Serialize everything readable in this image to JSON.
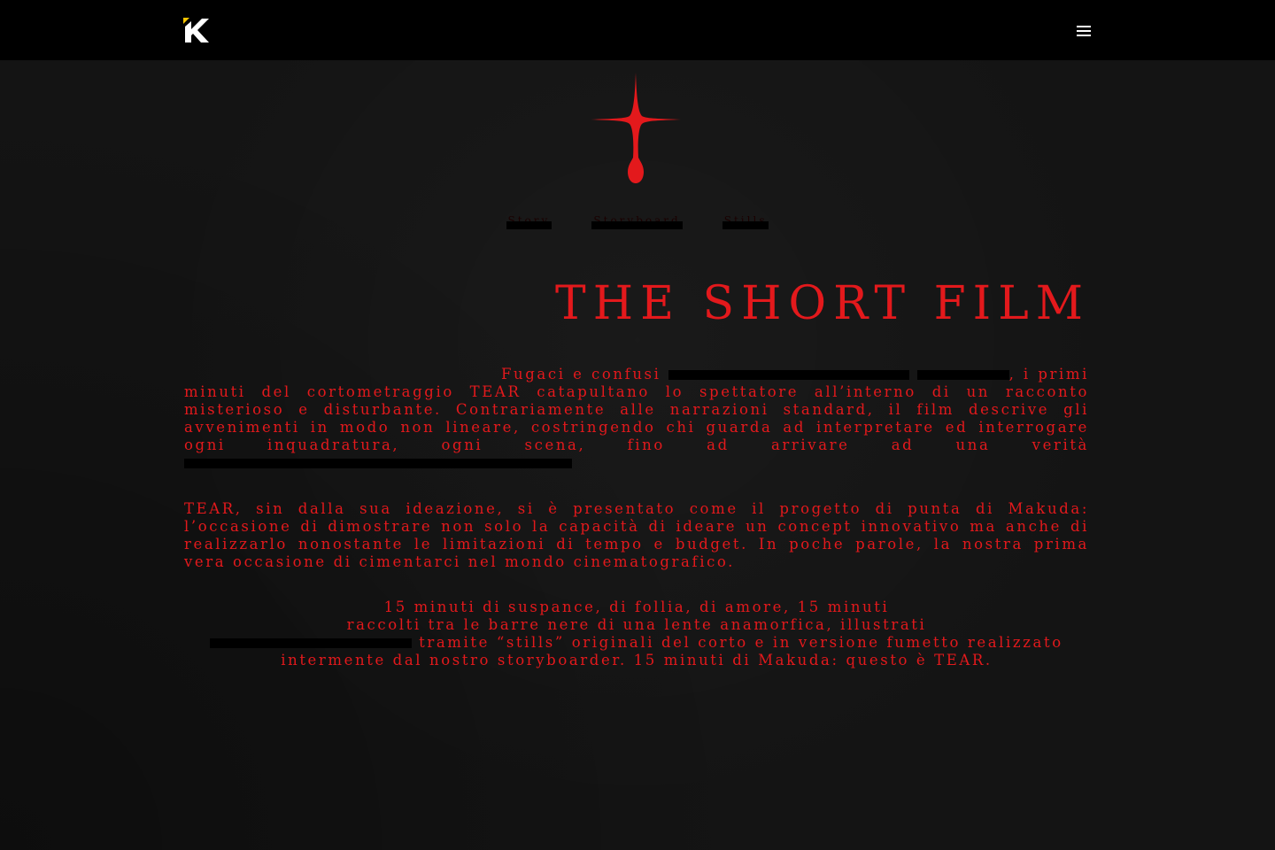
{
  "header": {
    "logo_alt": "K",
    "menu_label": "Menu"
  },
  "subnav": {
    "items": [
      "Story",
      "Storyboard",
      "Stills"
    ]
  },
  "page": {
    "title": "THE SHORT FILM"
  },
  "content": {
    "p1_a": "Fugaci e confusi",
    "p1_b": ", i primi minuti del cortometraggio TEAR catapultano lo spettatore all’interno di un racconto misterioso e disturbante. Contrariamente alle narrazioni standard, il film descrive gli avvenimenti in modo non lineare, costringendo chi guarda ad interpretare ed interrogare ogni inquadratura, ogni scena, fino ad arrivare ad una verità",
    "p2": "TEAR, sin dalla sua ideazione, si è presentato come il progetto di punta di Makuda: l’occasione di dimostrare non solo la capacità di ideare un concept innovativo ma anche di realizzarlo nonostante le limitazioni di tempo e budget. In poche parole, la nostra prima vera occasione di cimentarci nel mondo cinematografico.",
    "p3_line1": "15 minuti di suspance, di follia, di amore, 15 minuti",
    "p3_line2": "raccolti tra le barre nere di una lente anamorfica, illustrati",
    "p3_line3": "tramite “stills” originali del corto e in versione fumetto realizzato",
    "p3_line4": "intermente dal nostro storyboarder. 15 minuti di Makuda: questo è TEAR."
  },
  "colors": {
    "accent": "#e3191c",
    "background": "#141414",
    "topbar": "#000000",
    "logo_accent": "#f5c400"
  }
}
